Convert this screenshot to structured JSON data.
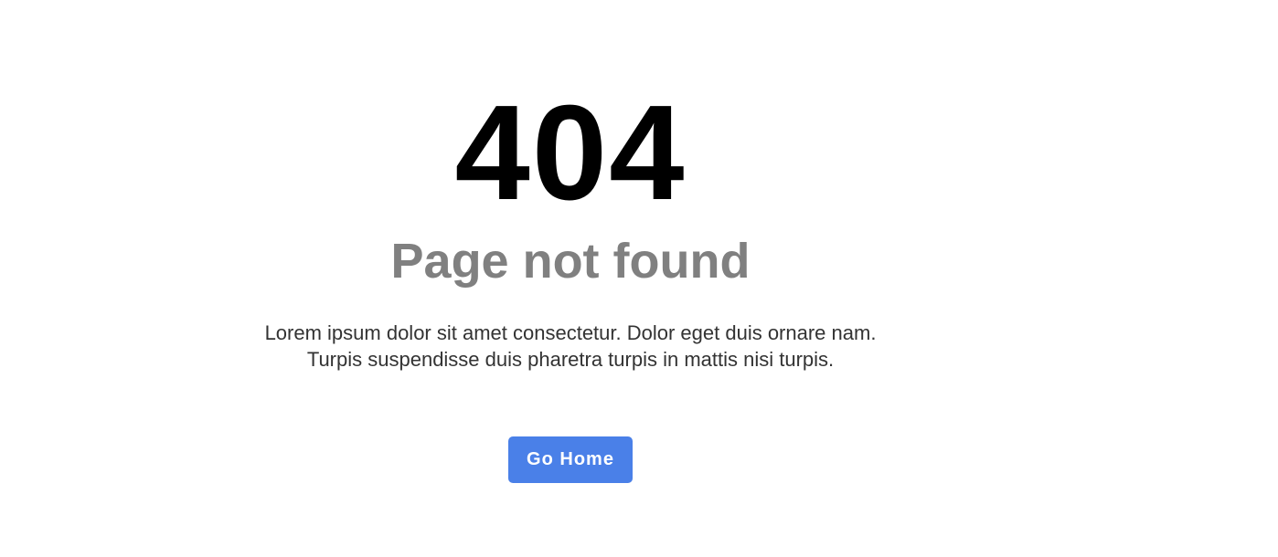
{
  "error": {
    "code": "404",
    "title": "Page not found",
    "description_line1": "Lorem ipsum dolor sit amet consectetur. Dolor eget duis ornare nam.",
    "description_line2": "Turpis suspendisse duis pharetra turpis in mattis nisi turpis."
  },
  "actions": {
    "home_label": "Go Home"
  },
  "colors": {
    "code": "#000000",
    "title": "#808080",
    "body_text": "#333333",
    "button_bg": "#4a80e8",
    "button_text": "#ffffff",
    "background": "#ffffff"
  }
}
